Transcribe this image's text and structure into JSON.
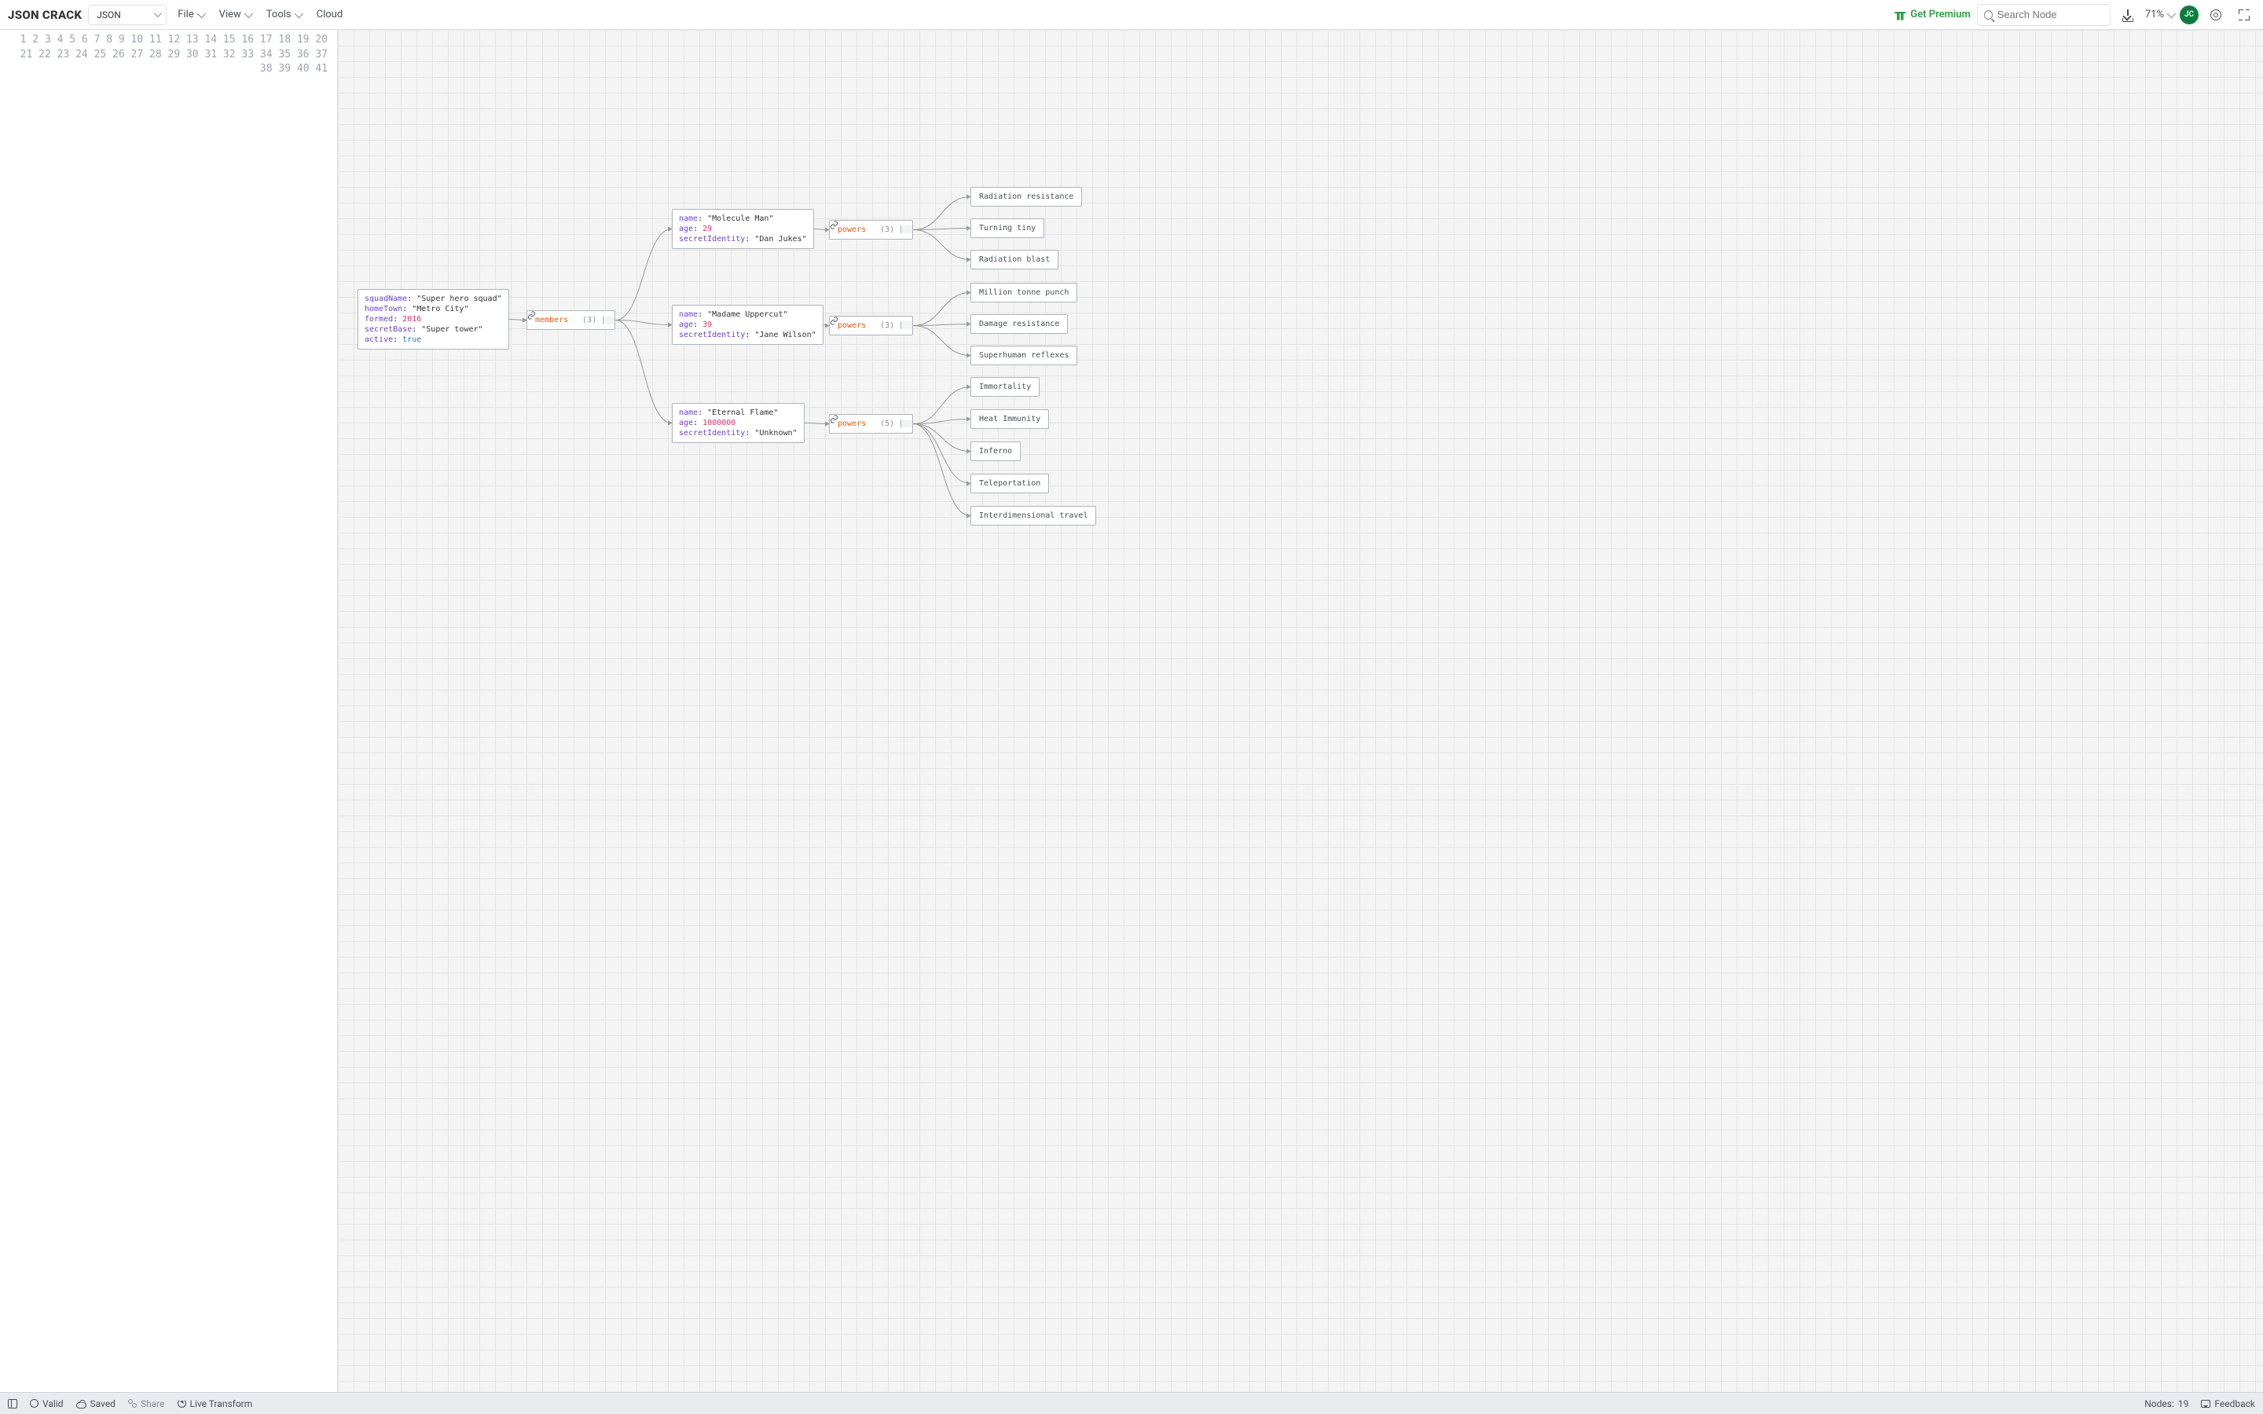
{
  "app": {
    "logo1": "JSON",
    "logo2": "CRACK"
  },
  "formatSelect": "JSON",
  "menus": {
    "file": "File",
    "view": "View",
    "tools": "Tools",
    "cloud": "Cloud"
  },
  "premium": "Get Premium",
  "search": {
    "placeholder": "Search Node"
  },
  "zoom": "71%",
  "avatar": "JC",
  "status": {
    "valid": "Valid",
    "saved": "Saved",
    "share": "Share",
    "live": "Live Transform",
    "nodesLabel": "Nodes:",
    "nodesCount": "19",
    "feedback": "Feedback"
  },
  "code": {
    "lines": 41,
    "json": {
      "squadName": "Super hero squad",
      "homeTown": "Metro City",
      "formed": 2016,
      "secretBase": "Super tower",
      "active": true,
      "members": [
        {
          "name": "Molecule Man",
          "age": 29,
          "secretIdentity": "Dan Jukes",
          "powers": [
            "Radiation resistance",
            "Turning tiny",
            "Radiation blast"
          ]
        },
        {
          "name": "Madame Uppercut",
          "age": 39,
          "secretIdentity": "Jane Wilson",
          "powers": [
            "Million tonne punch",
            "Damage resistance",
            "Superhuman reflexes"
          ]
        },
        {
          "name": "Eternal Flame",
          "age": 1000000,
          "secretIdentity": "Unknown",
          "powers": [
            "Immortality",
            "Heat Immunity",
            "Inferno",
            "Teleportation",
            "Interdimensional travel"
          ]
        }
      ]
    }
  },
  "graph": {
    "root": {
      "fields": [
        {
          "k": "squadName",
          "v": "\"Super hero squad\"",
          "t": "s"
        },
        {
          "k": "homeTown",
          "v": "\"Metro City\"",
          "t": "s"
        },
        {
          "k": "formed",
          "v": "2016",
          "t": "n"
        },
        {
          "k": "secretBase",
          "v": "\"Super tower\"",
          "t": "s"
        },
        {
          "k": "active",
          "v": "true",
          "t": "b"
        }
      ]
    },
    "membersLabel": "members",
    "membersCount": "(3)",
    "members": [
      {
        "fields": [
          {
            "k": "name",
            "v": "\"Molecule Man\"",
            "t": "s"
          },
          {
            "k": "age",
            "v": "29",
            "t": "n"
          },
          {
            "k": "secretIdentity",
            "v": "\"Dan Jukes\"",
            "t": "s"
          }
        ],
        "powersLabel": "powers",
        "powersCount": "(3)",
        "powers": [
          "Radiation resistance",
          "Turning tiny",
          "Radiation blast"
        ]
      },
      {
        "fields": [
          {
            "k": "name",
            "v": "\"Madame Uppercut\"",
            "t": "s"
          },
          {
            "k": "age",
            "v": "39",
            "t": "n"
          },
          {
            "k": "secretIdentity",
            "v": "\"Jane Wilson\"",
            "t": "s"
          }
        ],
        "powersLabel": "powers",
        "powersCount": "(3)",
        "powers": [
          "Million tonne punch",
          "Damage resistance",
          "Superhuman reflexes"
        ]
      },
      {
        "fields": [
          {
            "k": "name",
            "v": "\"Eternal Flame\"",
            "t": "s"
          },
          {
            "k": "age",
            "v": "1000000",
            "t": "n"
          },
          {
            "k": "secretIdentity",
            "v": "\"Unknown\"",
            "t": "s"
          }
        ],
        "powersLabel": "powers",
        "powersCount": "(5)",
        "powers": [
          "Immortality",
          "Heat Immunity",
          "Inferno",
          "Teleportation",
          "Interdimensional travel"
        ]
      }
    ]
  }
}
